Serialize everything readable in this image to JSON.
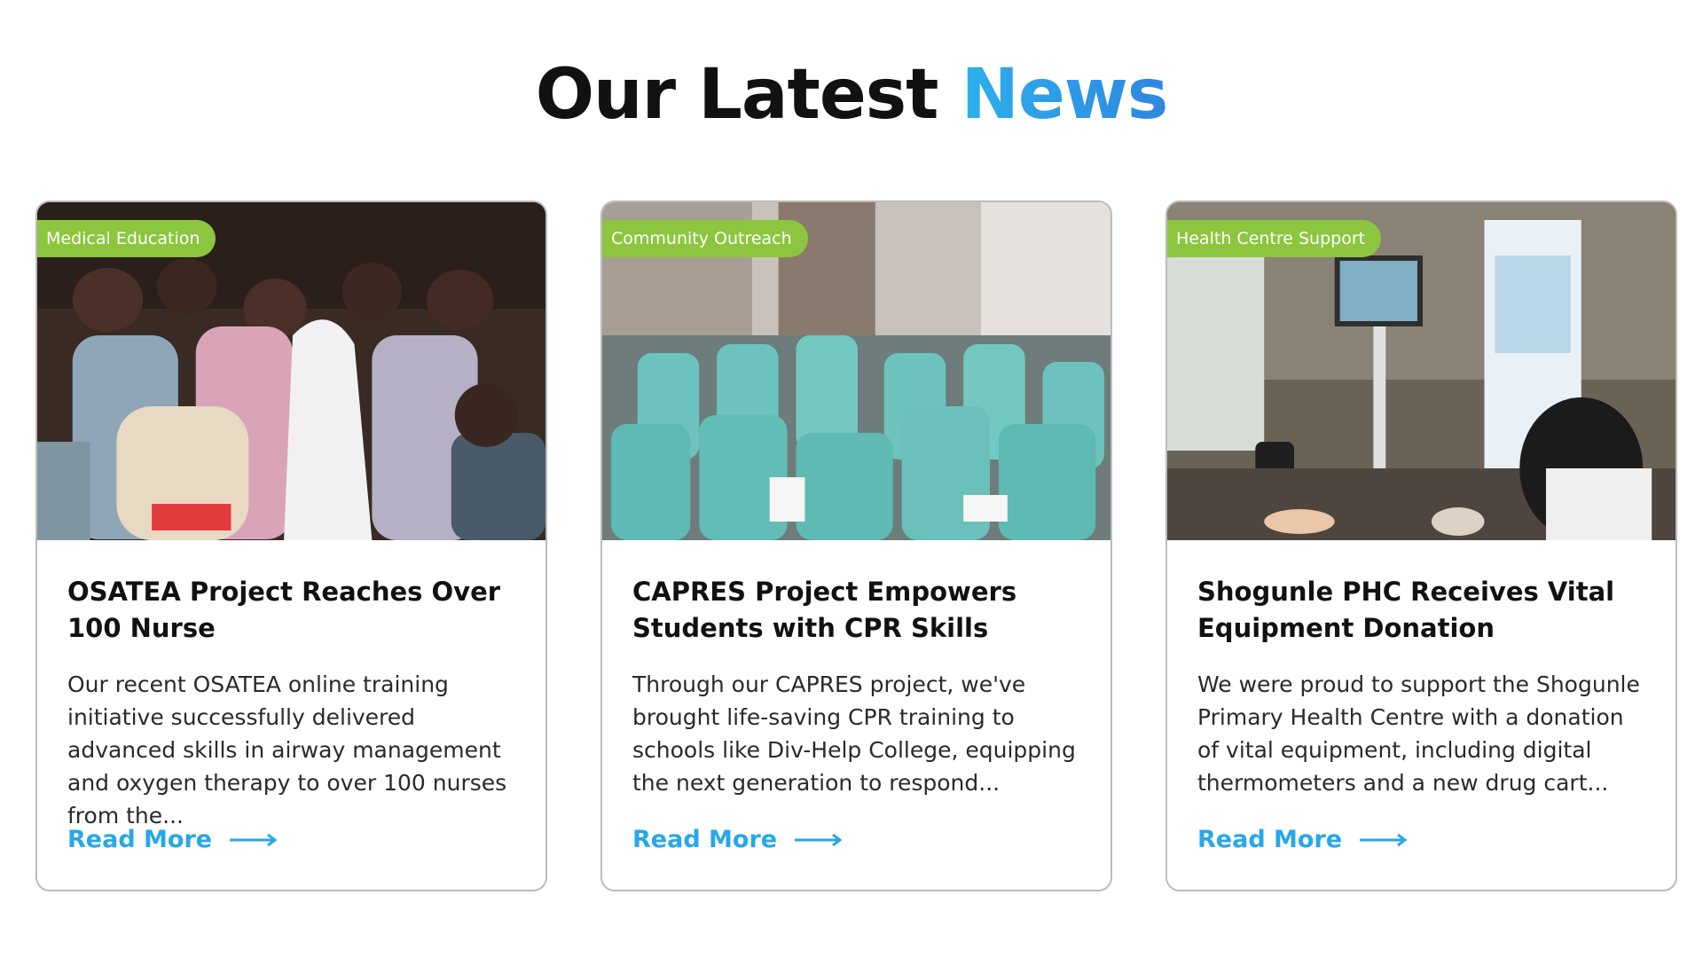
{
  "section": {
    "title_main": "Our Latest",
    "title_accent": "News"
  },
  "cards": [
    {
      "tag": "Medical Education",
      "title": "OSATEA Project Reaches Over 100 Nurse",
      "excerpt": "Our recent OSATEA online training initiative successfully delivered advanced skills in airway management and oxygen therapy to over 100 nurses from the...",
      "link_label": "Read More",
      "image_description": "nurses seated in a training hall"
    },
    {
      "tag": "Community Outreach",
      "title": "CAPRES Project Empowers Students with CPR Skills",
      "excerpt": "Through our CAPRES project, we've brought life-saving CPR training to schools like Div-Help College, equipping the next generation to respond...",
      "link_label": "Read More",
      "image_description": "students in teal uniforms seated in rows"
    },
    {
      "tag": "Health Centre Support",
      "title": "Shogunle PHC Receives Vital Equipment Donation",
      "excerpt": "We were proud to support the Shogunle Primary Health Centre with a donation of vital equipment, including digital thermometers and a new drug cart...",
      "link_label": "Read More",
      "image_description": "CPR demonstration with screen and banner"
    }
  ],
  "colors": {
    "accent_blue": "#27a7e8",
    "tag_green": "#8cc63f",
    "card_border": "#b9bcc0"
  }
}
